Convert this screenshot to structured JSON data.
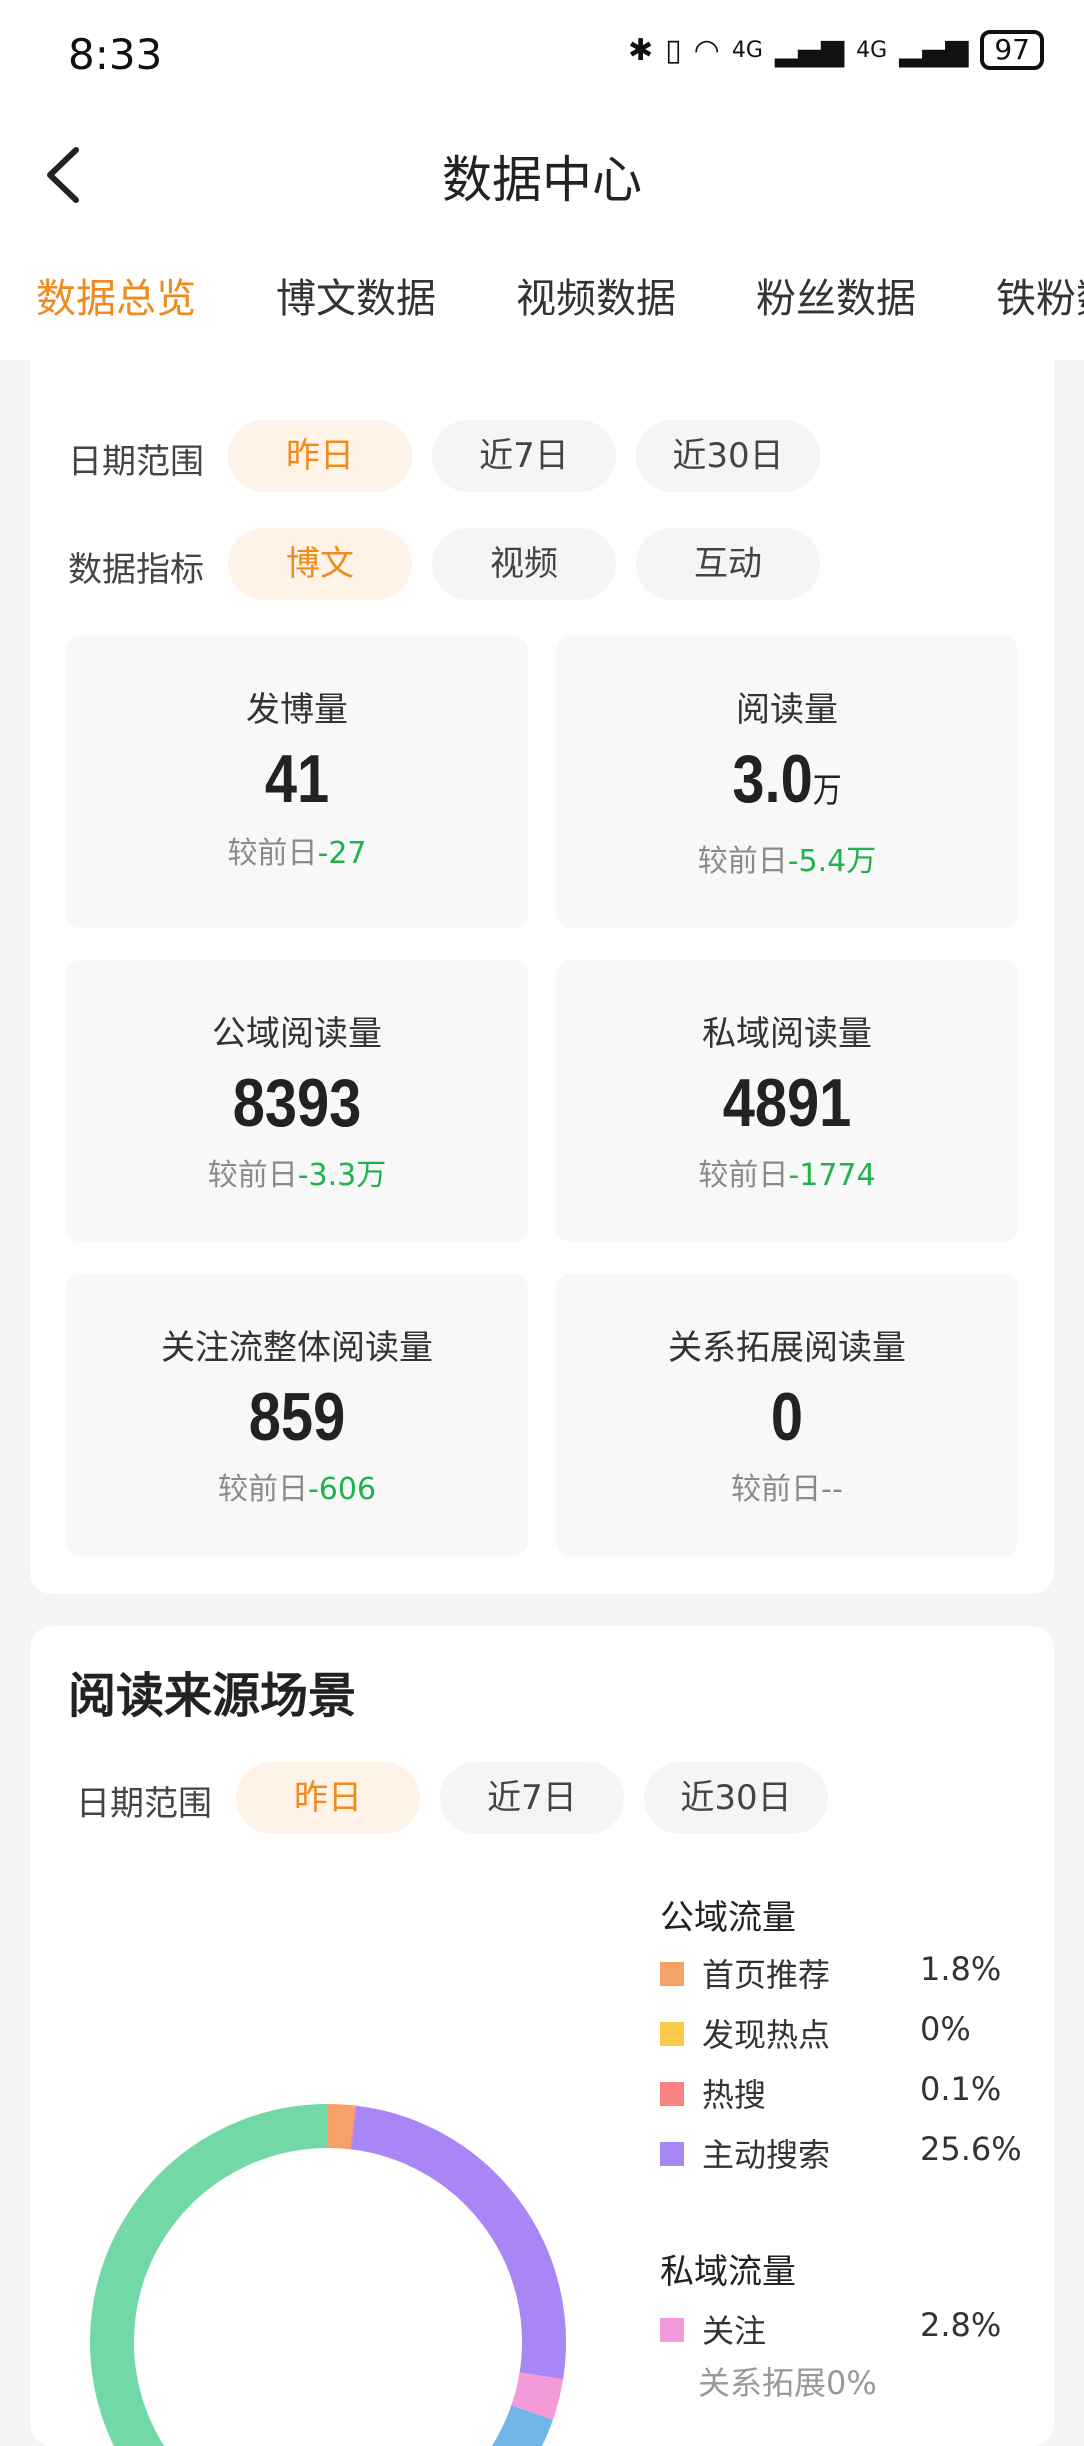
{
  "status_bar": {
    "time": "8:33",
    "signal_left": "4G",
    "signal_right": "4G",
    "battery": "97"
  },
  "header": {
    "title": "数据中心"
  },
  "tabs": [
    {
      "label": "数据总览",
      "active": true
    },
    {
      "label": "博文数据"
    },
    {
      "label": "视频数据"
    },
    {
      "label": "粉丝数据"
    },
    {
      "label": "铁粉数"
    }
  ],
  "overview": {
    "date_range_label": "日期范围",
    "date_options": [
      "昨日",
      "近7日",
      "近30日"
    ],
    "metric_label": "数据指标",
    "metric_options": [
      "博文",
      "视频",
      "互动"
    ],
    "cards": [
      {
        "title": "发博量",
        "value": "41",
        "unit": "",
        "compare_label": "较前日",
        "delta": "-27"
      },
      {
        "title": "阅读量",
        "value": "3.0",
        "unit": "万",
        "compare_label": "较前日",
        "delta": "-5.4万"
      },
      {
        "title": "公域阅读量",
        "value": "8393",
        "unit": "",
        "compare_label": "较前日",
        "delta": "-3.3万"
      },
      {
        "title": "私域阅读量",
        "value": "4891",
        "unit": "",
        "compare_label": "较前日",
        "delta": "-1774"
      },
      {
        "title": "关注流整体阅读量",
        "value": "859",
        "unit": "",
        "compare_label": "较前日",
        "delta": "-606"
      },
      {
        "title": "关系拓展阅读量",
        "value": "0",
        "unit": "",
        "compare_label": "较前日",
        "delta": "--"
      }
    ]
  },
  "read_source": {
    "title": "阅读来源场景",
    "date_range_label": "日期范围",
    "date_options": [
      "昨日",
      "近7日",
      "近30日"
    ],
    "public_title": "公域流量",
    "private_title": "私域流量",
    "public_items": [
      {
        "label": "首页推荐",
        "pct": "1.8%",
        "color": "#f6a06a"
      },
      {
        "label": "发现热点",
        "pct": "0%",
        "color": "#fbc94d"
      },
      {
        "label": "热搜",
        "pct": "0.1%",
        "color": "#f78383"
      },
      {
        "label": "主动搜索",
        "pct": "25.6%",
        "color": "#a986f5"
      }
    ],
    "private_items": [
      {
        "label": "关注",
        "pct": "2.8%",
        "color": "#f59ad8"
      }
    ],
    "private_sub_note": "关系拓展0%"
  },
  "chart_data": {
    "type": "pie",
    "title": "",
    "style": "donut",
    "start_angle_deg": 0,
    "slices": [
      {
        "label": "首页推荐",
        "value": 1.8,
        "color": "#f6a06a"
      },
      {
        "label": "发现热点",
        "value": 0,
        "color": "#fbc94d"
      },
      {
        "label": "热搜",
        "value": 0.1,
        "color": "#f78383"
      },
      {
        "label": "主动搜索",
        "value": 25.6,
        "color": "#a986f5"
      },
      {
        "label": "关注",
        "value": 2.8,
        "color": "#f59ad8"
      },
      {
        "label": "",
        "value": 9.5,
        "color": "#6fb6ea"
      },
      {
        "label": "",
        "value": 60.2,
        "color": "#72d8a6"
      }
    ]
  }
}
